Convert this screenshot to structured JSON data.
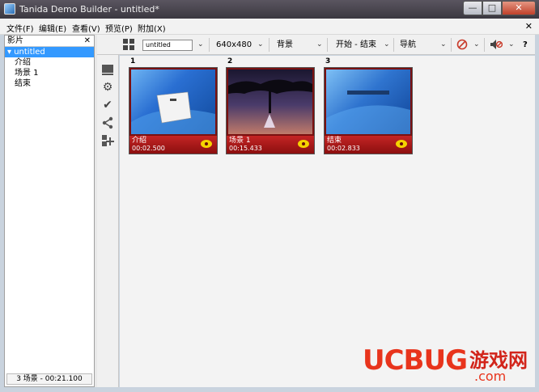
{
  "window": {
    "title": "Tanida Demo Builder - untitled*",
    "minimize": "—",
    "maximize": "□",
    "close": "✕"
  },
  "menu": {
    "items": [
      "文件(F)",
      "编辑(E)",
      "查看(V)",
      "预览(P)",
      "附加(X)"
    ],
    "close": "✕"
  },
  "left_panel": {
    "title": "影片",
    "close": "✕",
    "tree_root": "▾ untitled",
    "tree_items": [
      "介绍",
      "场景 1",
      "结束"
    ],
    "status": "3 场景 - 00:21.100"
  },
  "toolbar": {
    "project_name": "untitled",
    "resolution": "640x480",
    "background": "背景",
    "start_end": "开始 - 结束",
    "navigation": "导航",
    "help": "?"
  },
  "slides": [
    {
      "number": "1",
      "name": "介绍",
      "time": "00:02.500"
    },
    {
      "number": "2",
      "name": "场景 1",
      "time": "00:15.433"
    },
    {
      "number": "3",
      "name": "结束",
      "time": "00:02.833"
    }
  ],
  "watermark": {
    "logo": "UCBUG",
    "chinese": "游戏网",
    "domain": ".com"
  },
  "colors": {
    "slide_bar": "#b41a1a",
    "selection": "#3399ff",
    "watermark": "#e8341c"
  }
}
